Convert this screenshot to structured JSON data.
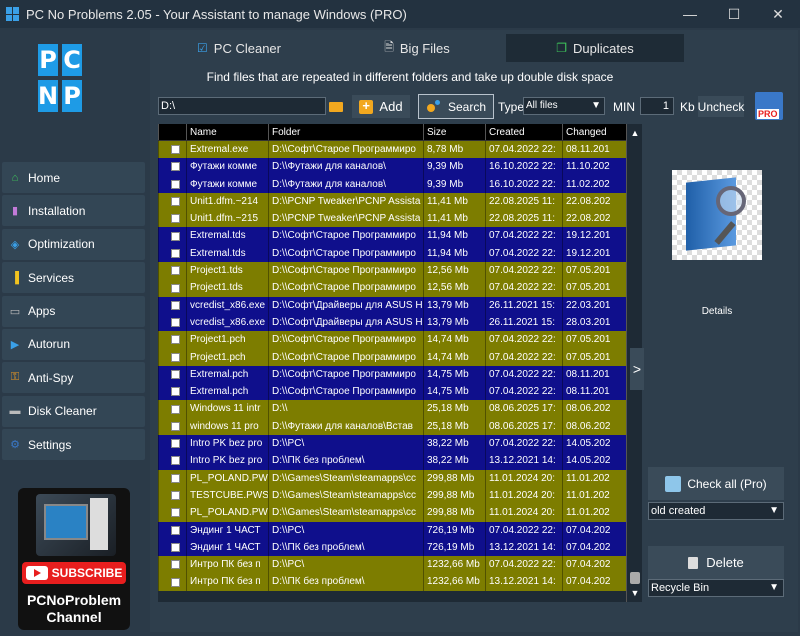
{
  "window": {
    "title": "PC No Problems 2.05 - Your Assistant to manage Windows (PRO)",
    "minimize": "—",
    "maximize": "☐",
    "close": "✕"
  },
  "logo": [
    "P",
    "C",
    "",
    "N",
    "P",
    ""
  ],
  "nav": [
    {
      "label": "Home",
      "icon": "home-icon",
      "glyph": "⌂",
      "color": "#3ec45a"
    },
    {
      "label": "Installation",
      "icon": "package-icon",
      "glyph": "▮",
      "color": "#c27ad8"
    },
    {
      "label": "Optimization",
      "icon": "layers-icon",
      "glyph": "◈",
      "color": "#3aa0e8"
    },
    {
      "label": "Services",
      "icon": "bars-icon",
      "glyph": "▐",
      "color": "#f2c31f"
    },
    {
      "label": "Apps",
      "icon": "monitor-icon",
      "glyph": "▭",
      "color": "#bbbbbb"
    },
    {
      "label": "Autorun",
      "icon": "play-icon",
      "glyph": "▶",
      "color": "#3aa0e8"
    },
    {
      "label": "Anti-Spy",
      "icon": "key-icon",
      "glyph": "⚿",
      "color": "#f29a1f"
    },
    {
      "label": "Disk Cleaner",
      "icon": "disk-icon",
      "glyph": "▬",
      "color": "#bbbbbb"
    },
    {
      "label": "Settings",
      "icon": "gear-icon",
      "glyph": "⚙",
      "color": "#3a78c8"
    }
  ],
  "channel": {
    "subscribe": "SUBSCRIBE",
    "line1": "PCNoProblem",
    "line2": "Channel"
  },
  "tabs": [
    {
      "label": "PC Cleaner",
      "icon": "checkbox-icon",
      "glyph": "☑"
    },
    {
      "label": "Big Files",
      "icon": "document-icon",
      "glyph": "🗎"
    },
    {
      "label": "Duplicates",
      "icon": "duplicate-icon",
      "glyph": "❐"
    }
  ],
  "subtitle": "Find files that are repeated in different folders and take up double disk space",
  "toolbar": {
    "path": "D:\\",
    "add": "Add",
    "search": "Search",
    "type_label": "Type",
    "type_value": "All files",
    "min_label": "MIN",
    "min_value": "1",
    "kb_label": "Kb",
    "uncheck": "Uncheck",
    "pro": "PRO"
  },
  "table": {
    "headers": [
      "Name",
      "Folder",
      "Size",
      "Created",
      "Changed"
    ],
    "rows": [
      {
        "c": "olive",
        "name": "Extremal.exe",
        "folder": "D:\\\\Софт\\Старое Программиро",
        "size": "8,78 Mb",
        "created": "07.04.2022 22:",
        "changed": "08.11.201"
      },
      {
        "c": "navy",
        "name": "Футажи комме",
        "folder": "D:\\\\Футажи для каналов\\",
        "size": "9,39 Mb",
        "created": "16.10.2022 22:",
        "changed": "11.10.202"
      },
      {
        "c": "navy",
        "name": "Футажи комме",
        "folder": "D:\\\\Футажи для каналов\\",
        "size": "9,39 Mb",
        "created": "16.10.2022 22:",
        "changed": "11.02.202"
      },
      {
        "c": "olive",
        "name": "Unit1.dfm.~214",
        "folder": "D:\\\\PCNP Tweaker\\PCNP Assista",
        "size": "11,41 Mb",
        "created": "22.08.2025 11:",
        "changed": "22.08.202"
      },
      {
        "c": "olive",
        "name": "Unit1.dfm.~215",
        "folder": "D:\\\\PCNP Tweaker\\PCNP Assista",
        "size": "11,41 Mb",
        "created": "22.08.2025 11:",
        "changed": "22.08.202"
      },
      {
        "c": "navy",
        "name": "Extremal.tds",
        "folder": "D:\\\\Софт\\Старое Программиро",
        "size": "11,94 Mb",
        "created": "07.04.2022 22:",
        "changed": "19.12.201"
      },
      {
        "c": "navy",
        "name": "Extremal.tds",
        "folder": "D:\\\\Софт\\Старое Программиро",
        "size": "11,94 Mb",
        "created": "07.04.2022 22:",
        "changed": "19.12.201"
      },
      {
        "c": "olive",
        "name": "Project1.tds",
        "folder": "D:\\\\Софт\\Старое Программиро",
        "size": "12,56 Mb",
        "created": "07.04.2022 22:",
        "changed": "07.05.201"
      },
      {
        "c": "olive",
        "name": "Project1.tds",
        "folder": "D:\\\\Софт\\Старое Программиро",
        "size": "12,56 Mb",
        "created": "07.04.2022 22:",
        "changed": "07.05.201"
      },
      {
        "c": "navy",
        "name": "vcredist_x86.exe",
        "folder": "D:\\\\Софт\\Драйверы для ASUS H",
        "size": "13,79 Mb",
        "created": "26.11.2021 15:",
        "changed": "22.03.201"
      },
      {
        "c": "navy",
        "name": "vcredist_x86.exe",
        "folder": "D:\\\\Софт\\Драйверы для ASUS H",
        "size": "13,79 Mb",
        "created": "26.11.2021 15:",
        "changed": "28.03.201"
      },
      {
        "c": "olive",
        "name": "Project1.pch",
        "folder": "D:\\\\Софт\\Старое Программиро",
        "size": "14,74 Mb",
        "created": "07.04.2022 22:",
        "changed": "07.05.201"
      },
      {
        "c": "olive",
        "name": "Project1.pch",
        "folder": "D:\\\\Софт\\Старое Программиро",
        "size": "14,74 Mb",
        "created": "07.04.2022 22:",
        "changed": "07.05.201"
      },
      {
        "c": "navy",
        "name": "Extremal.pch",
        "folder": "D:\\\\Софт\\Старое Программиро",
        "size": "14,75 Mb",
        "created": "07.04.2022 22:",
        "changed": "08.11.201"
      },
      {
        "c": "navy",
        "name": "Extremal.pch",
        "folder": "D:\\\\Софт\\Старое Программиро",
        "size": "14,75 Mb",
        "created": "07.04.2022 22:",
        "changed": "08.11.201"
      },
      {
        "c": "olive",
        "name": "Windows 11 intr",
        "folder": "D:\\\\",
        "size": "25,18 Mb",
        "created": "08.06.2025 17:",
        "changed": "08.06.202"
      },
      {
        "c": "olive",
        "name": "windows 11 pro",
        "folder": "D:\\\\Футажи для каналов\\Встав",
        "size": "25,18 Mb",
        "created": "08.06.2025 17:",
        "changed": "08.06.202"
      },
      {
        "c": "navy",
        "name": "Intro PK bez pro",
        "folder": "D:\\\\PC\\",
        "size": "38,22 Mb",
        "created": "07.04.2022 22:",
        "changed": "14.05.202"
      },
      {
        "c": "navy",
        "name": "Intro PK bez pro",
        "folder": "D:\\\\ПК без проблем\\",
        "size": "38,22 Mb",
        "created": "13.12.2021 14:",
        "changed": "14.05.202"
      },
      {
        "c": "olive",
        "name": "PL_POLAND.PWS",
        "folder": "D:\\\\Games\\Steam\\steamapps\\cc",
        "size": "299,88 Mb",
        "created": "11.01.2024 20:",
        "changed": "11.01.202"
      },
      {
        "c": "olive",
        "name": "TESTCUBE.PWS",
        "folder": "D:\\\\Games\\Steam\\steamapps\\cc",
        "size": "299,88 Mb",
        "created": "11.01.2024 20:",
        "changed": "11.01.202"
      },
      {
        "c": "olive",
        "name": "PL_POLAND.PWS",
        "folder": "D:\\\\Games\\Steam\\steamapps\\cc",
        "size": "299,88 Mb",
        "created": "11.01.2024 20:",
        "changed": "11.01.202"
      },
      {
        "c": "navy",
        "name": "Эндинг 1 ЧАСТ",
        "folder": "D:\\\\PC\\",
        "size": "726,19 Mb",
        "created": "07.04.2022 22:",
        "changed": "07.04.202"
      },
      {
        "c": "navy",
        "name": "Эндинг 1 ЧАСТ",
        "folder": "D:\\\\ПК без проблем\\",
        "size": "726,19 Mb",
        "created": "13.12.2021 14:",
        "changed": "07.04.202"
      },
      {
        "c": "olive",
        "name": "Интро ПК без п",
        "folder": "D:\\\\PC\\",
        "size": "1232,66 Mb",
        "created": "07.04.2022 22:",
        "changed": "07.04.202"
      },
      {
        "c": "olive",
        "name": "Интро ПК без п",
        "folder": "D:\\\\ПК без проблем\\",
        "size": "1232,66 Mb",
        "created": "13.12.2021 14:",
        "changed": "07.04.202"
      }
    ]
  },
  "scroll_up": "▲",
  "scroll_down": "▼",
  "expand": ">",
  "right": {
    "details": "Details",
    "check_all": "Check all (Pro)",
    "sort_value": "old created",
    "delete": "Delete",
    "delete_target": "Recycle Bin"
  },
  "colors": {
    "olive_row": "#7d7d00",
    "navy_row": "#0f0f8c",
    "accent": "#1e9be6"
  }
}
